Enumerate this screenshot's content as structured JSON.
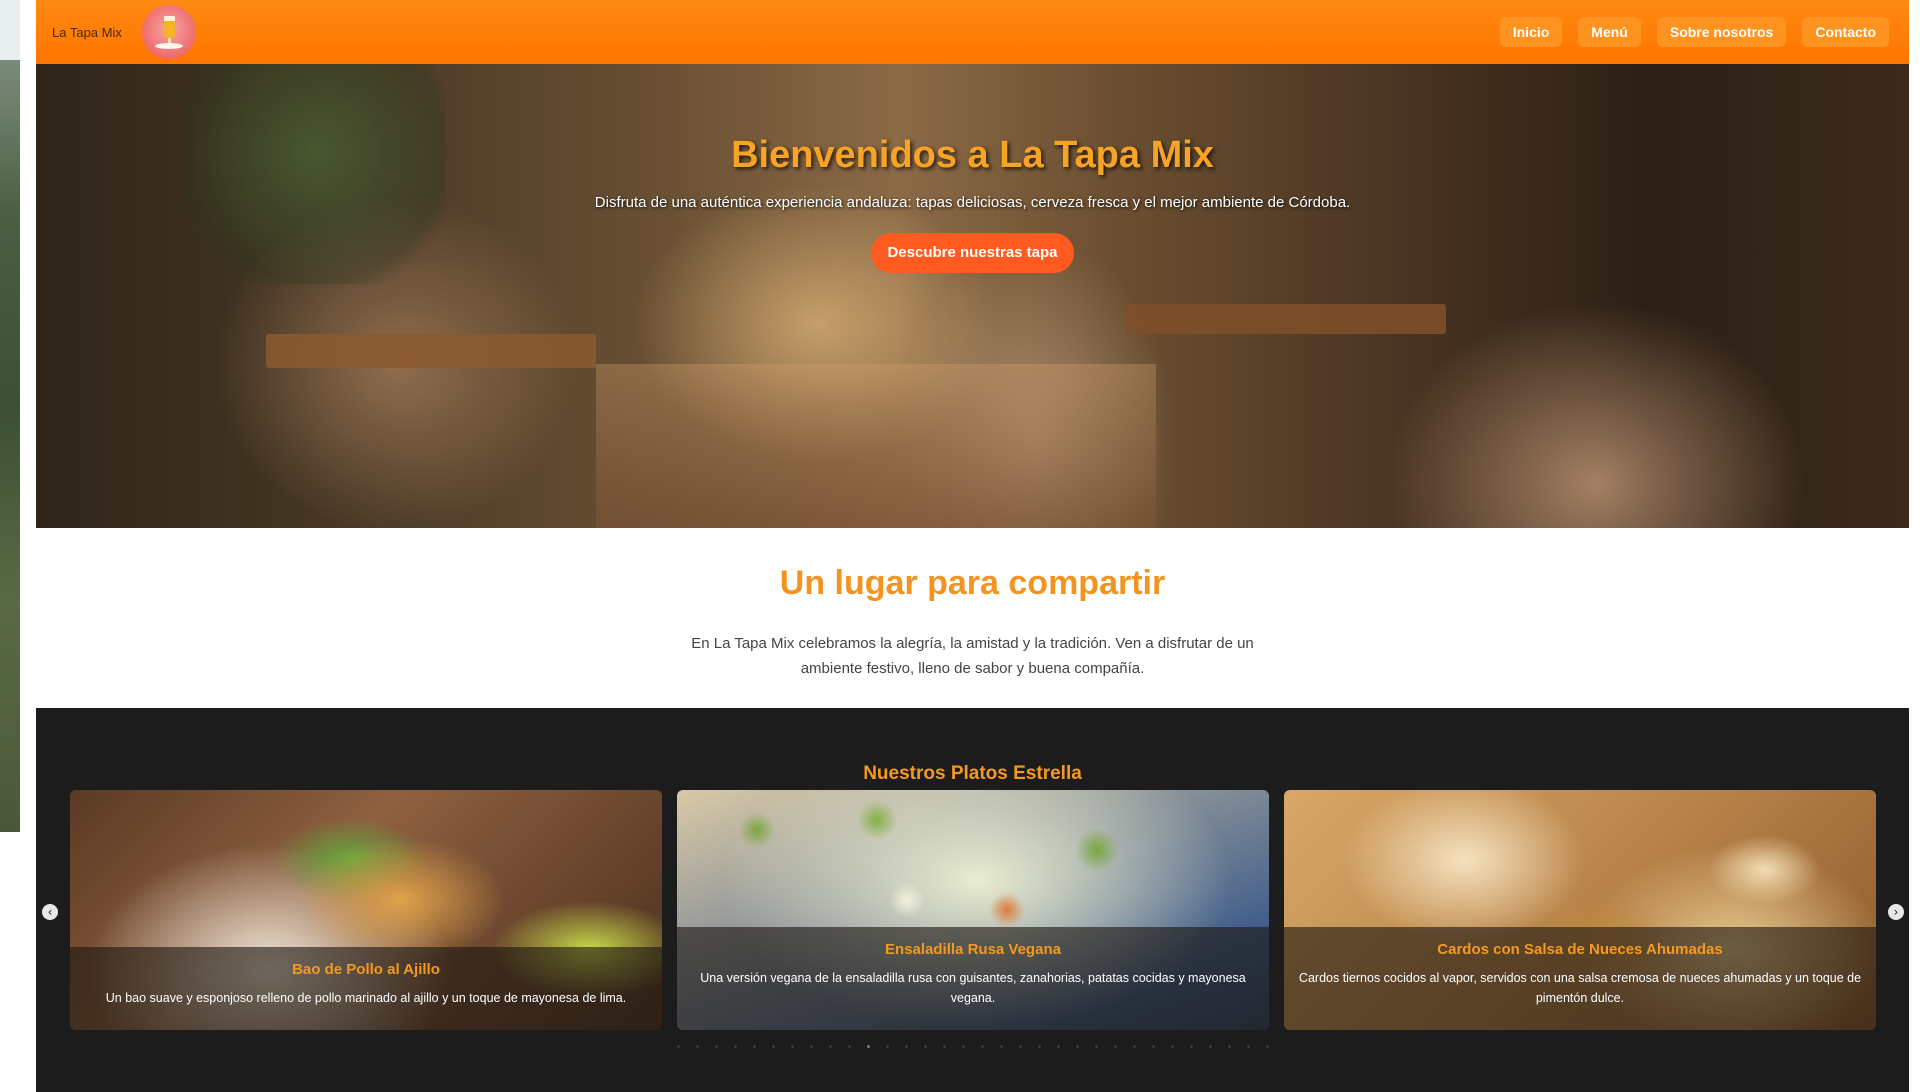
{
  "header": {
    "brand": "La Tapa Mix",
    "nav": [
      "Inicio",
      "Menú",
      "Sobre nosotros",
      "Contacto"
    ]
  },
  "hero": {
    "title": "Bienvenidos a La Tapa Mix",
    "subtitle": "Disfruta de una auténtica experiencia andaluza: tapas deliciosas, cerveza fresca y el mejor ambiente de Córdoba.",
    "cta": "Descubre nuestras tapa"
  },
  "about": {
    "title": "Un lugar para compartir",
    "text": "En La Tapa Mix celebramos la alegría, la amistad y la tradición. Ven a disfrutar de un ambiente festivo, lleno de sabor y buena compañía."
  },
  "dishes": {
    "title": "Nuestros Platos Estrella",
    "cards": [
      {
        "name": "Bao de Pollo al Ajillo",
        "description": "Un bao suave y esponjoso relleno de pollo marinado al ajillo y un toque de mayonesa de lima."
      },
      {
        "name": "Ensaladilla Rusa Vegana",
        "description": "Una versión vegana de la ensaladilla rusa con guisantes, zanahorias, patatas cocidas y mayonesa vegana."
      },
      {
        "name": "Cardos con Salsa de Nueces Ahumadas",
        "description": "Cardos tiernos cocidos al vapor, servidos con una salsa cremosa de nueces ahumadas y un toque de pimentón dulce."
      }
    ],
    "carousel": {
      "prev_icon": "chevron-left-icon",
      "next_icon": "chevron-right-icon",
      "dot_count": 32,
      "active_dot": 10
    }
  },
  "colors": {
    "header_orange": "#ff7a00",
    "accent_orange": "#f39320",
    "cta_red_orange": "#ff5a1f",
    "dark_section": "#1c1c1c"
  }
}
